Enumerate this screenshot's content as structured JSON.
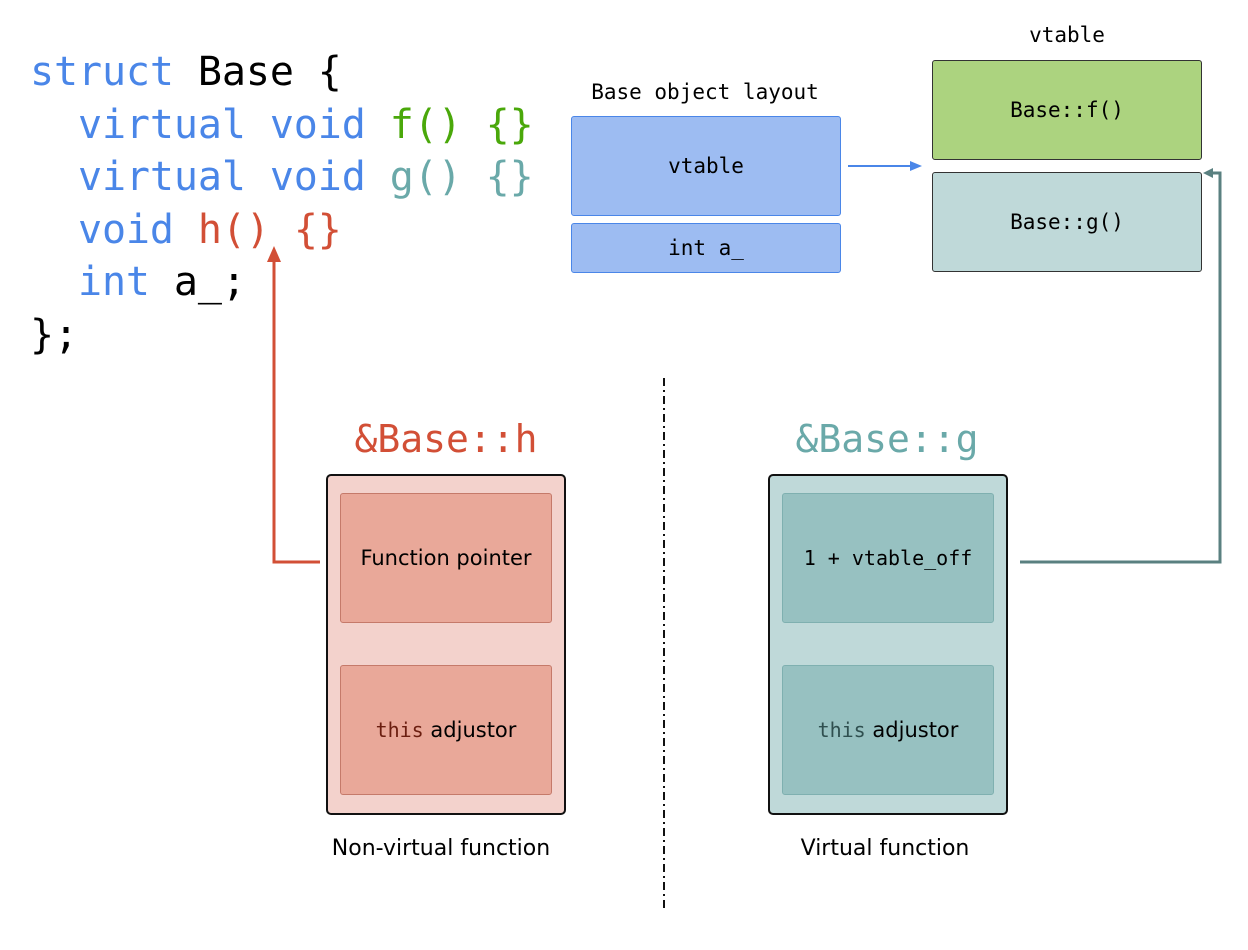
{
  "code": {
    "line1": {
      "kw": "struct",
      "name": " Base {"
    },
    "line2": {
      "indent": "  ",
      "kw": "virtual void",
      "fn": " f() {}"
    },
    "line3": {
      "indent": "  ",
      "kw": "virtual void",
      "fn": " g() {}"
    },
    "line4": {
      "indent": "  ",
      "kw": "void",
      "fn": " h() {}"
    },
    "line5": {
      "indent": "  ",
      "kw": "int",
      "name": " a_;"
    },
    "line6": "};"
  },
  "layout": {
    "title": "Base object layout",
    "fields": [
      "vtable",
      "int a_"
    ]
  },
  "vtable": {
    "title": "vtable",
    "entries": [
      "Base::f()",
      "Base::g()"
    ]
  },
  "nonvirtual": {
    "title": "&Base::h",
    "slot1": "Function pointer",
    "slot2_code": "this",
    "slot2_text": " adjustor",
    "caption": "Non-virtual function"
  },
  "virtual": {
    "title": "&Base::g",
    "slot1": "1 + vtable_off",
    "slot2_code": "this",
    "slot2_text": " adjustor",
    "caption": "Virtual function"
  },
  "colors": {
    "blue": "#4a86e8",
    "green": "#4aa80a",
    "teal": "#6aa9a9",
    "red": "#d24f36",
    "layout_fill": "#9dbcf2",
    "f_fill": "#acd37f",
    "g_fill": "#bfd9d9",
    "red_outer": "#f3d2cc",
    "red_inner": "#e9a899",
    "teal_outer": "#bfd9d9",
    "teal_inner": "#97c1c1"
  }
}
